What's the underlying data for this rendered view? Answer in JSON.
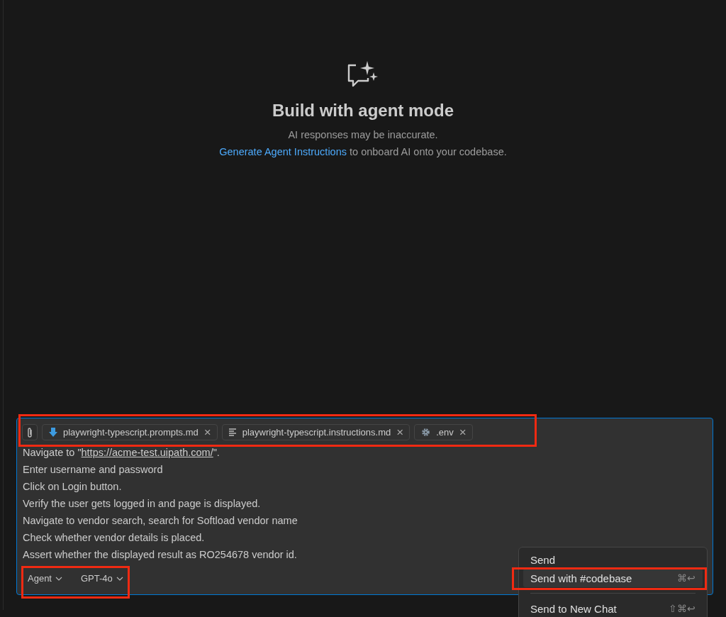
{
  "welcome": {
    "title": "Build with agent mode",
    "subtitle": "AI responses may be inaccurate.",
    "link": "Generate Agent Instructions",
    "link_rest": " to onboard AI onto your codebase."
  },
  "attachments": [
    {
      "kind": "prompt",
      "name": "playwright-typescript.prompts.md",
      "close": "×"
    },
    {
      "kind": "instructions",
      "name": "playwright-typescript.instructions.md",
      "close": "×"
    },
    {
      "kind": "settings",
      "name": ".env",
      "close": "×"
    }
  ],
  "prompt": {
    "first_line": {
      "before": "Navigate to \"",
      "link": "https://acme-test.uipath.com/",
      "after": "\"."
    },
    "lines": [
      "Enter username and password",
      "Click on Login button.",
      "Verify the user gets logged in and page is displayed.",
      "Navigate to vendor search, search for Softload vendor name",
      "Check whether vendor details is placed.",
      "Assert whether the displayed result as RO254678 vendor id."
    ]
  },
  "mode_picker": "Agent",
  "model_picker": "GPT-4o",
  "send_menu": [
    {
      "label": "Send",
      "selected": false,
      "separator_before": false
    },
    {
      "label": "Send with #codebase",
      "shortcut": "⌘↩",
      "selected": true,
      "separator_before": false
    },
    {
      "label": "Send to New Chat",
      "shortcut": "⇧⌘↩",
      "selected": false,
      "separator_before": true
    }
  ]
}
